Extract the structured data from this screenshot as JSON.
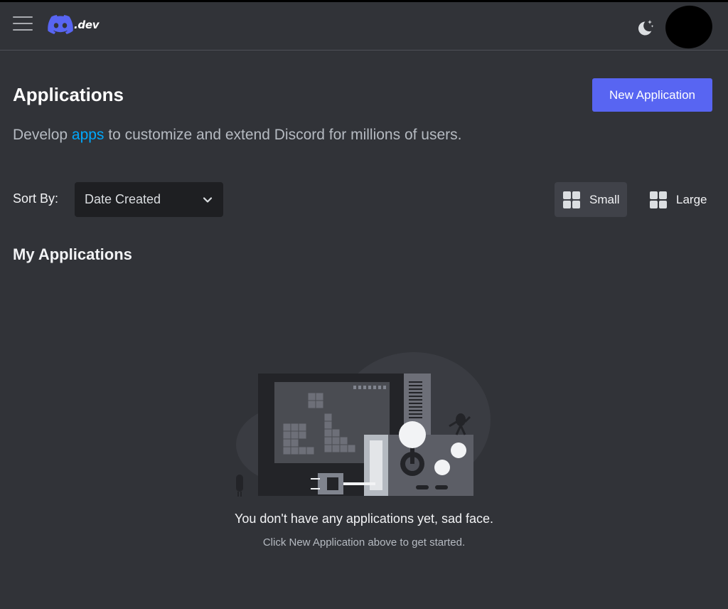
{
  "header": {
    "logo_text": ".dev"
  },
  "page": {
    "title": "Applications",
    "new_button": "New Application",
    "subtitle_pre": "Develop ",
    "subtitle_link": "apps",
    "subtitle_post": " to customize and extend Discord for millions of users."
  },
  "sort": {
    "label": "Sort By:",
    "selected": "Date Created"
  },
  "view": {
    "small_label": "Small",
    "large_label": "Large",
    "selected": "Small"
  },
  "section": {
    "title": "My Applications"
  },
  "empty_state": {
    "title": "You don't have any applications yet, sad face.",
    "subtitle": "Click New Application above to get started."
  },
  "colors": {
    "background": "#313338",
    "accent": "#5865f2",
    "link": "#00a8fc"
  }
}
